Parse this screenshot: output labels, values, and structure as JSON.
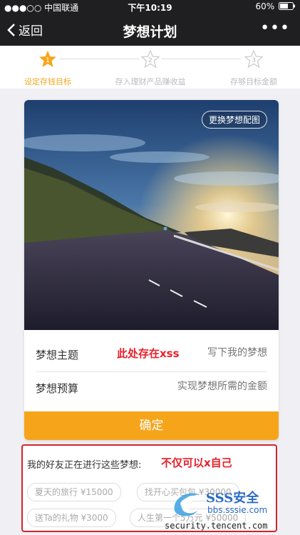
{
  "status_bar": {
    "carrier": "●●●○○ 中国联通",
    "time": "下午10:19",
    "battery": "60%"
  },
  "nav": {
    "back_label": "返回",
    "title": "梦想计划",
    "more_label": "•••"
  },
  "steps": [
    {
      "label": "设定存钱目标",
      "number": "1",
      "active": true
    },
    {
      "label": "存入理财产品赚收益",
      "number": "2",
      "active": false
    },
    {
      "label": "存够目标金额",
      "number": "3",
      "active": false
    }
  ],
  "card": {
    "change_image_label": "更换梦想配图",
    "theme_label": "梦想主题",
    "theme_placeholder": "写下我的梦想",
    "budget_label": "梦想预算",
    "budget_placeholder": "实现梦想所需的金额",
    "confirm_label": "确定"
  },
  "annotations": {
    "xss_note": "此处存在xss",
    "self_note": "不仅可以x自己"
  },
  "friends": {
    "title": "我的好友正在进行这些梦想:",
    "tags": [
      "夏天的旅行 ¥15000",
      "找开心买包包 ¥30000",
      "送Ta的礼物 ¥3000",
      "人生第一个5万元 ¥50000"
    ]
  },
  "watermark": {
    "brand": "SSS安全",
    "url": "bbs.sssie.com",
    "site": "security.tencent.com"
  },
  "colors": {
    "accent": "#f6a51b",
    "nav_bg": "#1f1f21",
    "annotation_red": "#e8202a"
  }
}
